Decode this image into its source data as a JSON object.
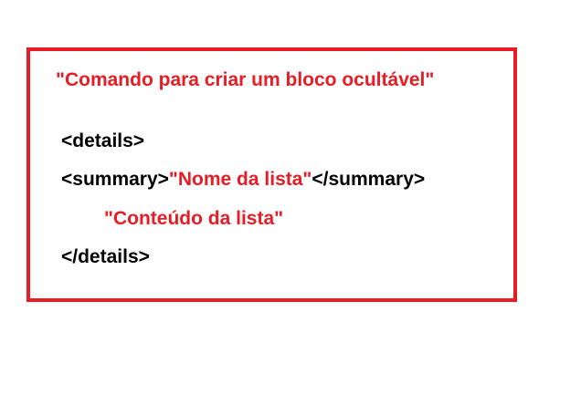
{
  "title": "\"Comando para criar um bloco ocultável\"",
  "code": {
    "line1": "<details>",
    "line2_open": "<summary>",
    "line2_name": "\"Nome da lista\"",
    "line2_close": "</summary>",
    "line3": "\"Conteúdo da lista\"",
    "line4": "</details>"
  },
  "colors": {
    "accent": "#e81c24",
    "text": "#000000",
    "background": "#ffffff"
  }
}
